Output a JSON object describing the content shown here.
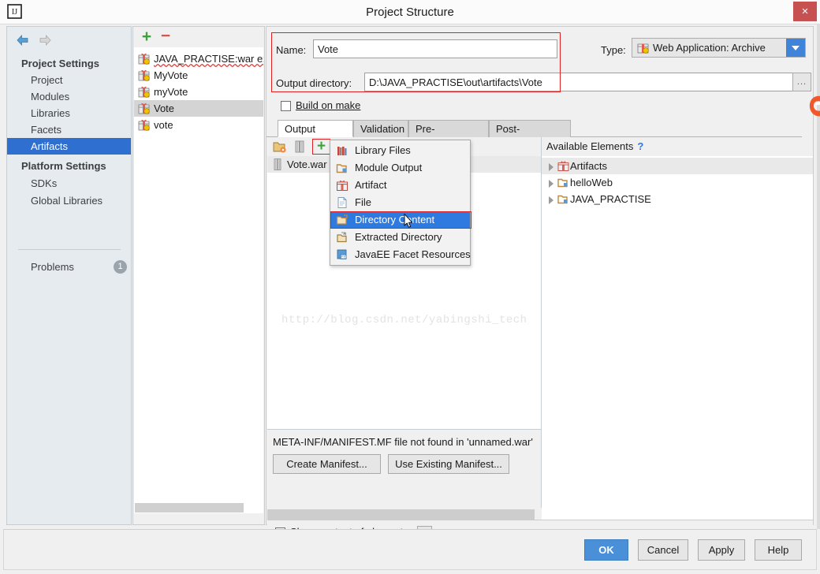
{
  "window": {
    "title": "Project Structure",
    "logo_icon": "intellij-idea-logo",
    "close_icon": "close-icon",
    "close_label": "×"
  },
  "sidebar": {
    "back_icon": "arrow-left-icon",
    "forward_icon": "arrow-right-icon",
    "groups": [
      {
        "label": "Project Settings",
        "items": [
          {
            "label": "Project",
            "selected": false
          },
          {
            "label": "Modules",
            "selected": false
          },
          {
            "label": "Libraries",
            "selected": false
          },
          {
            "label": "Facets",
            "selected": false
          },
          {
            "label": "Artifacts",
            "selected": true
          }
        ]
      },
      {
        "label": "Platform Settings",
        "items": [
          {
            "label": "SDKs",
            "selected": false
          },
          {
            "label": "Global Libraries",
            "selected": false
          }
        ]
      }
    ],
    "problems": {
      "label": "Problems",
      "badge": "1"
    }
  },
  "artifacts_panel": {
    "add_icon": "plus-icon",
    "add_label": "+",
    "remove_icon": "minus-icon",
    "remove_label": "−",
    "items": [
      {
        "label": "JAVA_PRACTISE:war ex",
        "icon": "artifact-icon",
        "selected": false,
        "error": true
      },
      {
        "label": "MyVote",
        "icon": "artifact-icon",
        "selected": false,
        "error": false
      },
      {
        "label": "myVote",
        "icon": "artifact-icon",
        "selected": false,
        "error": false
      },
      {
        "label": "Vote",
        "icon": "artifact-icon",
        "selected": true,
        "error": false
      },
      {
        "label": "vote",
        "icon": "artifact-icon",
        "selected": false,
        "error": false
      }
    ]
  },
  "detail": {
    "name_label": "Name:",
    "name_value": "Vote",
    "type_label": "Type:",
    "type_value": "Web Application: Archive",
    "type_icon": "artifact-icon",
    "type_arrow_icon": "chevron-down-icon",
    "output_dir_label": "Output directory:",
    "output_dir_value": "D:\\JAVA_PRACTISE\\out\\artifacts\\Vote",
    "browse_label": "...",
    "build_on_make_label": "Build on make",
    "build_on_make_checked": false,
    "highlight_color": "#e02020",
    "tabs": [
      {
        "label": "Output Layout",
        "active": true
      },
      {
        "label": "Validation",
        "active": false
      },
      {
        "label": "Pre-processing",
        "active": false
      },
      {
        "label": "Post-processing",
        "active": false
      }
    ]
  },
  "output_layout": {
    "toolbar": [
      {
        "icon": "create-directory-icon",
        "label": ""
      },
      {
        "icon": "create-archive-icon",
        "label": ""
      },
      {
        "icon": "add-copy-icon",
        "label": "+"
      }
    ],
    "root_row": {
      "label": "Vote.war",
      "icon": "archive-icon"
    },
    "watermark": "http://blog.csdn.net/yabingshi_tech",
    "popup_menu": {
      "items": [
        {
          "label": "Library Files",
          "icon": "library-files-icon",
          "highlighted": false
        },
        {
          "label": "Module Output",
          "icon": "module-output-icon",
          "highlighted": false
        },
        {
          "label": "Artifact",
          "icon": "artifact-icon",
          "highlighted": false
        },
        {
          "label": "File",
          "icon": "file-icon",
          "highlighted": false
        },
        {
          "label": "Directory Content",
          "icon": "directory-content-icon",
          "highlighted": true
        },
        {
          "label": "Extracted Directory",
          "icon": "extracted-directory-icon",
          "highlighted": false
        },
        {
          "label": "JavaEE Facet Resources",
          "icon": "javaee-facet-icon",
          "highlighted": false
        }
      ]
    },
    "manifest_message": "META-INF/MANIFEST.MF file not found in 'unnamed.war'",
    "create_manifest_label": "Create Manifest...",
    "use_existing_manifest_label": "Use Existing Manifest..."
  },
  "available_elements": {
    "title": "Available Elements",
    "help_icon": "help-icon",
    "help_label": "?",
    "rows": [
      {
        "label": "Artifacts",
        "icon": "artifact-icon",
        "selected": true
      },
      {
        "label": "helloWeb",
        "icon": "module-icon",
        "selected": false
      },
      {
        "label": "JAVA_PRACTISE",
        "icon": "module-icon",
        "selected": false
      }
    ]
  },
  "footer_options": {
    "show_content_label": "Show content of elements",
    "show_content_checked": false,
    "show_content_browse_label": "..."
  },
  "footer": {
    "buttons": [
      {
        "label": "OK",
        "primary": true
      },
      {
        "label": "Cancel",
        "primary": false
      },
      {
        "label": "Apply",
        "primary": false
      },
      {
        "label": "Help",
        "primary": false
      }
    ]
  }
}
